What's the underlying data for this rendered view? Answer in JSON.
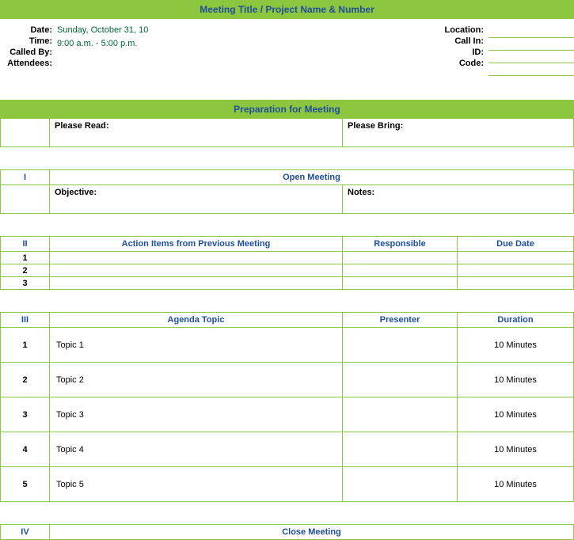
{
  "header_title": "Meeting Title / Project Name & Number",
  "meta": {
    "labels": {
      "date": "Date:",
      "time": "Time:",
      "called_by": "Called By:",
      "attendees": "Attendees:",
      "location": "Location:",
      "call_in": "Call In:",
      "id": "ID:",
      "code": "Code:"
    },
    "date": "Sunday, October 31, 10",
    "time": "9:00 a.m. - 5:00 p.m.",
    "called_by": "",
    "attendees": ""
  },
  "prep": {
    "header": "Preparation for Meeting",
    "read_label": "Please Read:",
    "bring_label": "Please Bring:"
  },
  "open": {
    "roman": "I",
    "header": "Open Meeting",
    "objective_label": "Objective:",
    "notes_label": "Notes:"
  },
  "actions": {
    "roman": "II",
    "col1": "Action Items from Previous Meeting",
    "col2": "Responsible",
    "col3": "Due Date",
    "rows": [
      {
        "n": "1",
        "item": "",
        "resp": "",
        "due": ""
      },
      {
        "n": "2",
        "item": "",
        "resp": "",
        "due": ""
      },
      {
        "n": "3",
        "item": "",
        "resp": "",
        "due": ""
      }
    ]
  },
  "agenda": {
    "roman": "III",
    "col1": "Agenda Topic",
    "col2": "Presenter",
    "col3": "Duration",
    "rows": [
      {
        "n": "1",
        "topic": "Topic 1",
        "presenter": "",
        "duration": "10 Minutes"
      },
      {
        "n": "2",
        "topic": "Topic 2",
        "presenter": "",
        "duration": "10 Minutes"
      },
      {
        "n": "3",
        "topic": "Topic 3",
        "presenter": "",
        "duration": "10 Minutes"
      },
      {
        "n": "4",
        "topic": "Topic 4",
        "presenter": "",
        "duration": "10 Minutes"
      },
      {
        "n": "5",
        "topic": "Topic 5",
        "presenter": "",
        "duration": "10 Minutes"
      }
    ]
  },
  "close": {
    "roman": "IV",
    "header": "Close Meeting"
  }
}
